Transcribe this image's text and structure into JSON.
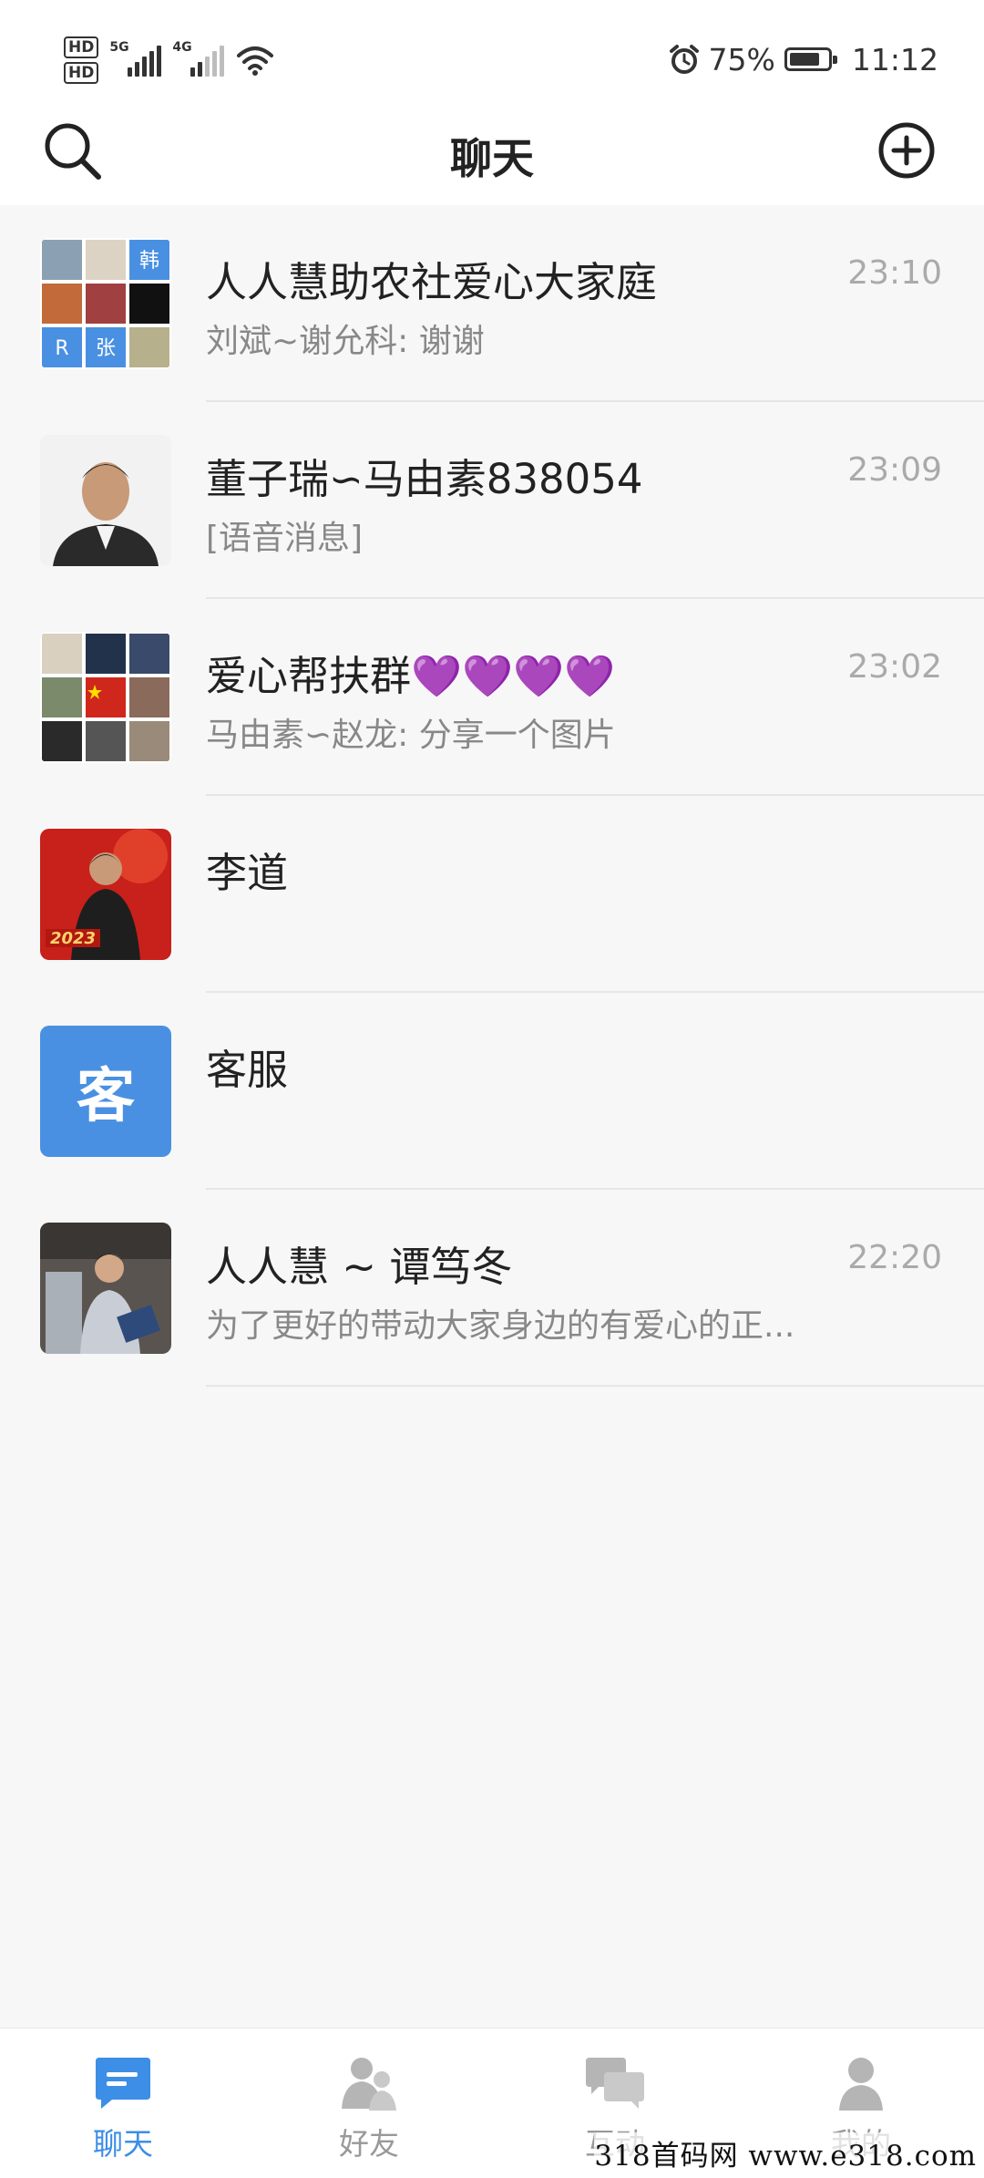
{
  "status_bar": {
    "hd1": "HD",
    "hd2": "HD",
    "net1": "5G",
    "net2": "4G",
    "battery": "75%",
    "time": "11:12"
  },
  "header": {
    "title": "聊天",
    "search_icon": "search-icon",
    "add_icon": "plus-circle-icon"
  },
  "chats": [
    {
      "name": "人人慧助农社爱心大家庭",
      "preview": "刘斌~谢允科: 谢谢",
      "time": "23:10"
    },
    {
      "name": "董子瑞∽马由素838054",
      "preview": "[语音消息]",
      "time": "23:09"
    },
    {
      "name": "爱心帮扶群💜💜💜💜",
      "preview": "马由素∽赵龙: 分享一个图片",
      "time": "23:02"
    },
    {
      "name": "李道",
      "preview": "",
      "time": ""
    },
    {
      "name": "客服",
      "preview": "",
      "time": "",
      "avatar_text": "客"
    },
    {
      "name": "人人慧 ~ 谭笃冬",
      "preview": "为了更好的带动大家身边的有爱心的正...",
      "time": "22:20"
    }
  ],
  "group_avatar_tiles": {
    "tile_a": "韩",
    "tile_b": "R",
    "tile_c": "张"
  },
  "avatar_badge": "2023",
  "tabs": [
    {
      "label": "聊天",
      "active": true
    },
    {
      "label": "好友",
      "active": false
    },
    {
      "label": "互动",
      "active": false
    },
    {
      "label": "我的",
      "active": false
    }
  ],
  "watermark": "318首码网 www.e318.com",
  "colors": {
    "accent": "#3d8ee6",
    "inactive": "#999999",
    "tile_blue": "#4a90e2"
  }
}
